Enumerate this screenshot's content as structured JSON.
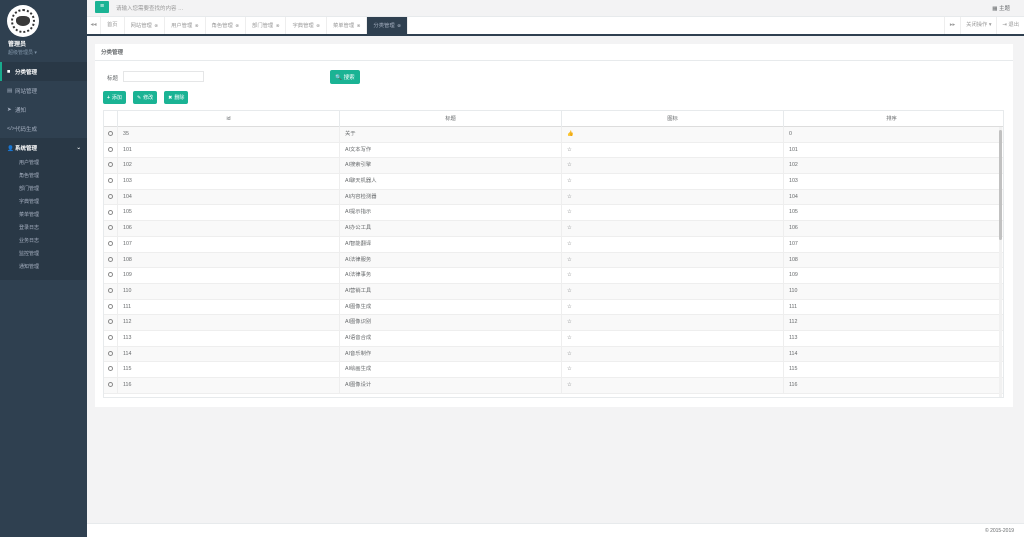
{
  "profile": {
    "name": "管理员",
    "role": "超级管理员 ▾"
  },
  "sidebar": {
    "items": [
      {
        "icon": "■",
        "label": "分类管理",
        "active": true
      },
      {
        "icon": "▤",
        "label": "网站管理"
      },
      {
        "icon": "➤",
        "label": "通知"
      },
      {
        "icon": "</>",
        "label": "代码生成"
      }
    ],
    "system": {
      "icon": "👤",
      "label": "系统管理",
      "chevron": "⌄"
    },
    "subitems": [
      "用户管理",
      "角色管理",
      "部门管理",
      "字典管理",
      "菜单管理",
      "登录日志",
      "业务日志",
      "监控管理",
      "通知管理"
    ]
  },
  "topbar": {
    "menu_icon": "≡",
    "search_placeholder": "请输入您需要查找的内容 …",
    "theme_label": "▦ 主题"
  },
  "tabs": {
    "prev": "◂◂",
    "next": "▸▸",
    "items": [
      "首页",
      "网站管理",
      "用户管理",
      "角色管理",
      "部门管理",
      "字典管理",
      "菜单管理",
      "分类管理"
    ],
    "close": "⊗",
    "close_ops": "关闭操作 ▾",
    "exit": "⇥ 退出"
  },
  "panel": {
    "title": "分类管理"
  },
  "search": {
    "label": "标题",
    "button": "🔍 搜索"
  },
  "toolbar": {
    "add": "添加",
    "edit": "修改",
    "delete": "删除"
  },
  "table": {
    "headers": [
      "id",
      "标题",
      "图标",
      "排序"
    ],
    "rows": [
      {
        "id": "35",
        "title": "关于",
        "icon": "👍",
        "sort": "0"
      },
      {
        "id": "101",
        "title": "AI文本写作",
        "icon": "☆",
        "sort": "101"
      },
      {
        "id": "102",
        "title": "AI搜索引擎",
        "icon": "☆",
        "sort": "102"
      },
      {
        "id": "103",
        "title": "AI聊天机器人",
        "icon": "☆",
        "sort": "103"
      },
      {
        "id": "104",
        "title": "AI内容检测器",
        "icon": "☆",
        "sort": "104"
      },
      {
        "id": "105",
        "title": "AI提示指示",
        "icon": "☆",
        "sort": "105"
      },
      {
        "id": "106",
        "title": "AI办公工具",
        "icon": "☆",
        "sort": "106"
      },
      {
        "id": "107",
        "title": "AI智能翻译",
        "icon": "☆",
        "sort": "107"
      },
      {
        "id": "108",
        "title": "AI法律服务",
        "icon": "☆",
        "sort": "108"
      },
      {
        "id": "109",
        "title": "AI法律事务",
        "icon": "☆",
        "sort": "109"
      },
      {
        "id": "110",
        "title": "AI营销工具",
        "icon": "☆",
        "sort": "110"
      },
      {
        "id": "111",
        "title": "AI图像生成",
        "icon": "☆",
        "sort": "111"
      },
      {
        "id": "112",
        "title": "AI图像识别",
        "icon": "☆",
        "sort": "112"
      },
      {
        "id": "113",
        "title": "AI语音合成",
        "icon": "☆",
        "sort": "113"
      },
      {
        "id": "114",
        "title": "AI音乐制作",
        "icon": "☆",
        "sort": "114"
      },
      {
        "id": "115",
        "title": "AI绘画生成",
        "icon": "☆",
        "sort": "115"
      },
      {
        "id": "116",
        "title": "AI图像设计",
        "icon": "☆",
        "sort": "116"
      }
    ]
  },
  "footer": {
    "copyright": "© 2015-2019"
  },
  "colors": {
    "accent": "#1ab394",
    "sidebar": "#2f4050",
    "sidebar_dark": "#293846"
  }
}
